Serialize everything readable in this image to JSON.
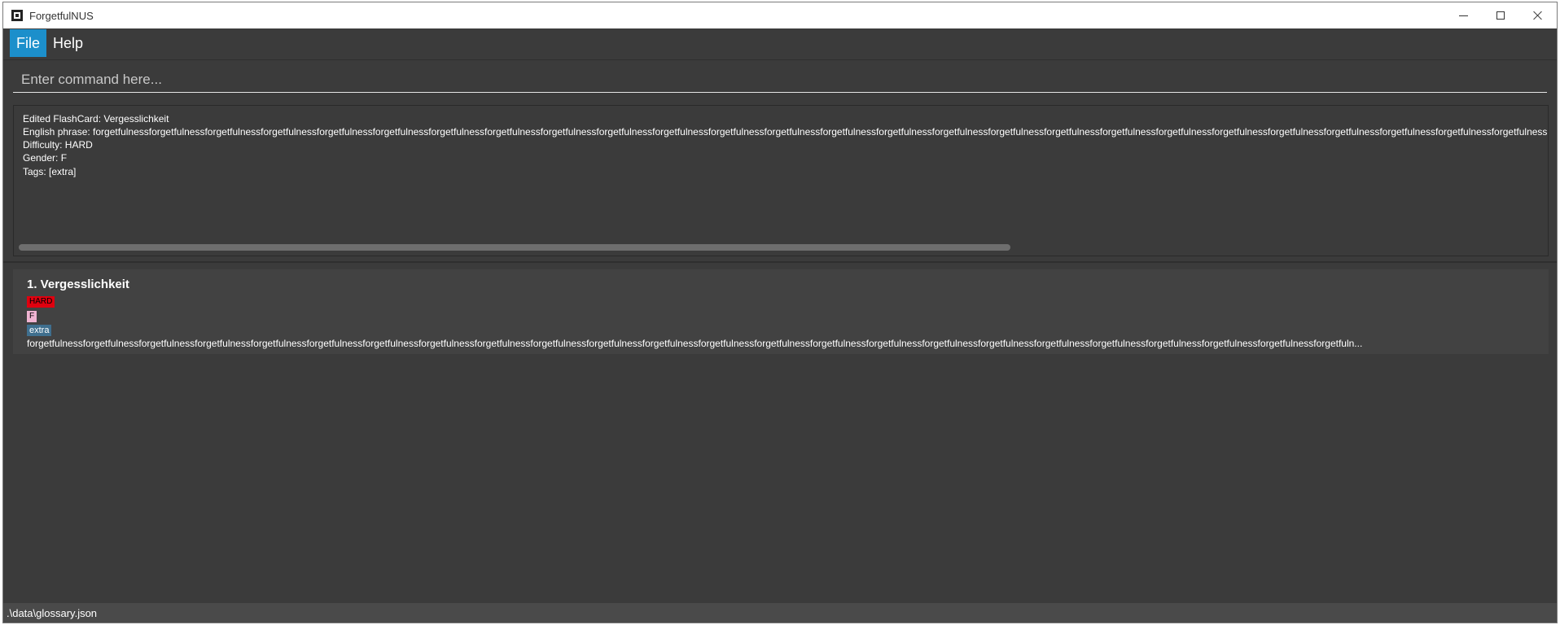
{
  "window": {
    "title": "ForgetfulNUS"
  },
  "menu": {
    "file_label": "File",
    "help_label": "Help"
  },
  "command": {
    "placeholder": "Enter command here...",
    "value": ""
  },
  "result": {
    "lines": [
      "Edited FlashCard: Vergesslichkeit",
      "English phrase: forgetfulnessforgetfulnessforgetfulnessforgetfulnessforgetfulnessforgetfulnessforgetfulnessforgetfulnessforgetfulnessforgetfulnessforgetfulnessforgetfulnessforgetfulnessforgetfulnessforgetfulnessforgetfulnessforgetfulnessforgetfulnessforgetfulnessforgetfulnessforgetfulnessforgetfulnessforgetfulnessforgetfulnessforgetfulnessforgetfulness",
      "Difficulty: HARD",
      "Gender: F",
      "Tags: [extra]"
    ]
  },
  "cards": [
    {
      "title": "1.  Vergesslichkeit",
      "difficulty": "HARD",
      "gender": "F",
      "tag": "extra",
      "phrase": "forgetfulnessforgetfulnessforgetfulnessforgetfulnessforgetfulnessforgetfulnessforgetfulnessforgetfulnessforgetfulnessforgetfulnessforgetfulnessforgetfulnessforgetfulnessforgetfulnessforgetfulnessforgetfulnessforgetfulnessforgetfulnessforgetfulnessforgetfulnessforgetfulnessforgetfulnessforgetfulnessforgetfuln..."
    }
  ],
  "status": {
    "file_path": ".\\data\\glossary.json"
  },
  "colors": {
    "window_bg": "#3b3b3b",
    "menu_active": "#1c8fcb",
    "difficulty_hard": "#e0000f",
    "gender_f": "#f0b4d2",
    "tag_bg": "#3f6f8e"
  },
  "icons": {
    "app": "app-icon",
    "minimize": "minimize-icon",
    "maximize": "maximize-icon",
    "close": "close-icon"
  }
}
